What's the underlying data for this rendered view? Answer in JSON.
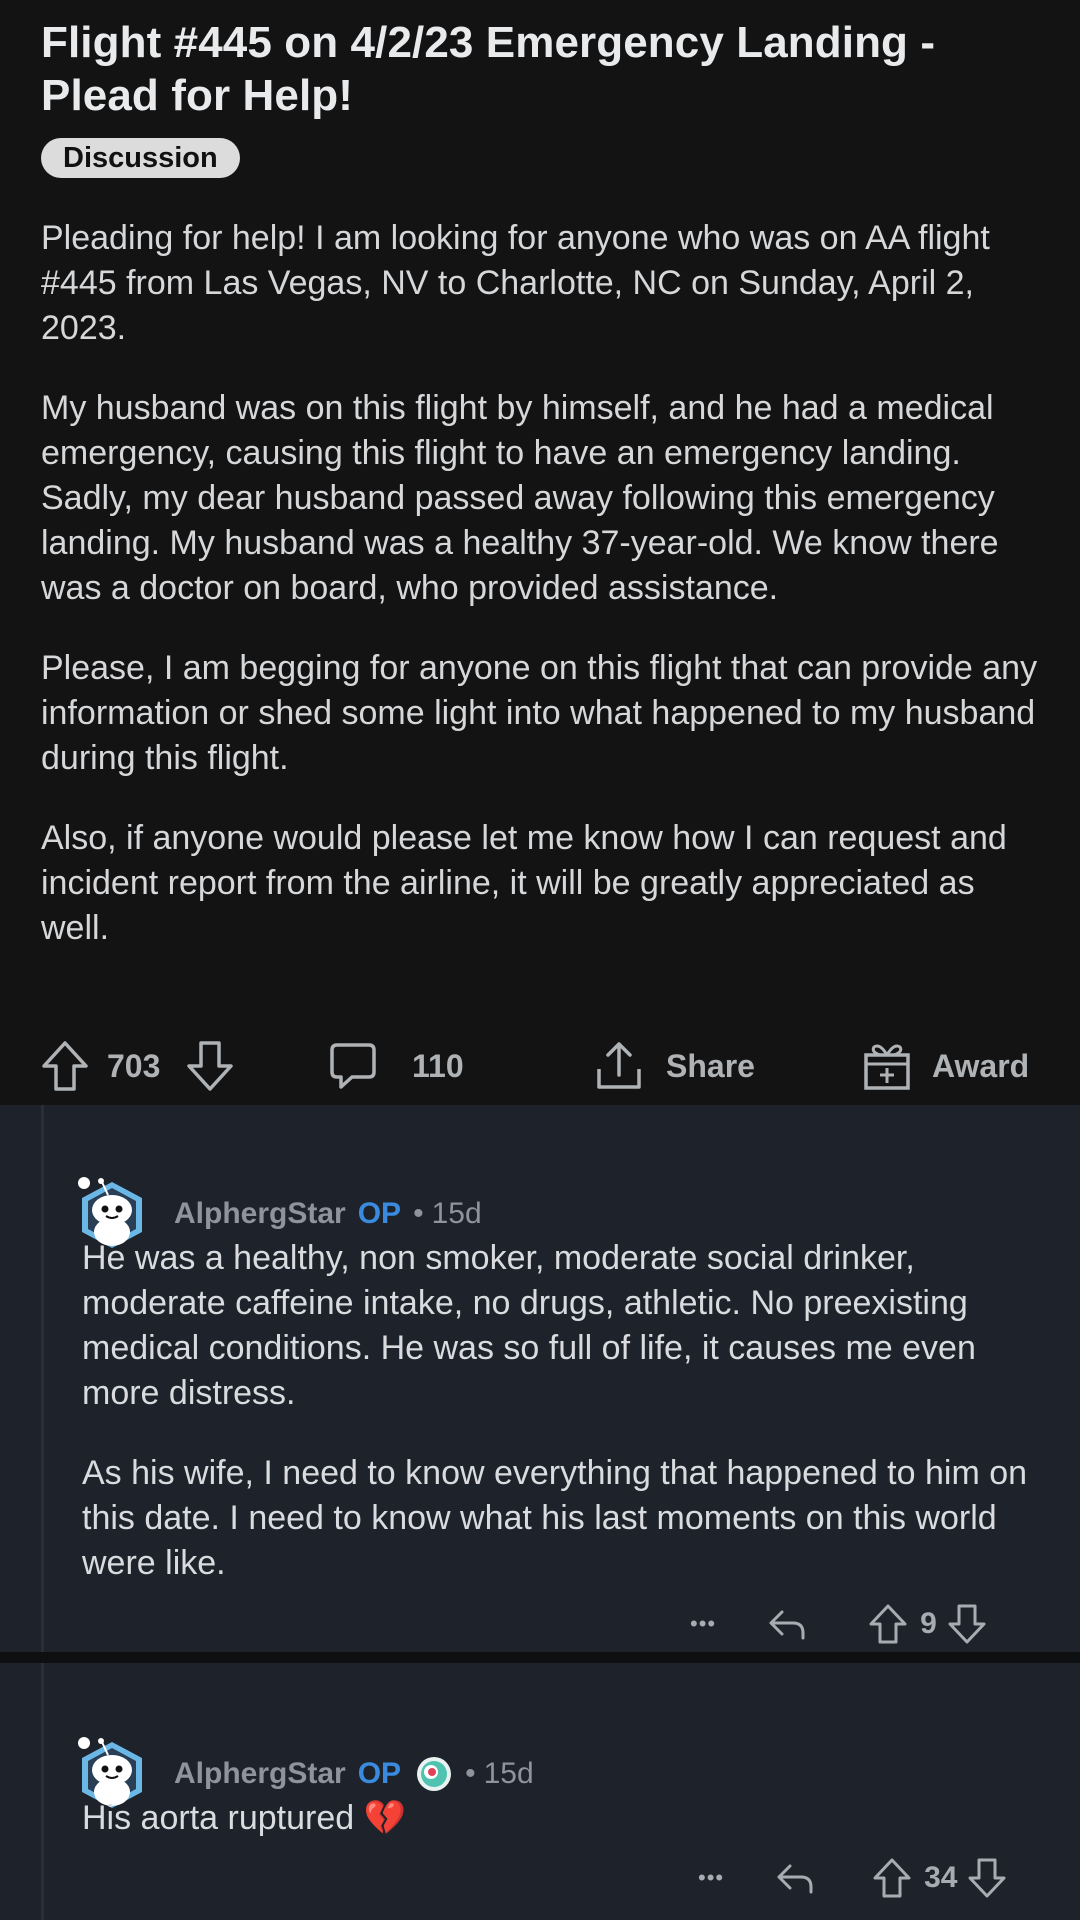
{
  "post": {
    "title": "Flight #445 on 4/2/23 Emergency Landing - Plead for Help!",
    "flair": "Discussion",
    "paragraphs": [
      "Pleading for help! I am looking for anyone who was on AA flight #445 from Las Vegas, NV to Charlotte, NC on Sunday, April 2, 2023.",
      "My husband was on this flight by himself, and he had a medical emergency, causing this flight to have an emergency landing. Sadly, my dear husband passed away following this emergency landing. My husband was a healthy 37-year-old. We know there was a doctor on board, who provided assistance.",
      "Please, I am begging for anyone on this flight that can provide any information or shed some light into what happened to my husband during this flight.",
      "Also, if anyone would please let me know how I can request and incident report from the airline, it will be greatly appreciated as well."
    ],
    "actions": {
      "votes": "703",
      "comments": "110",
      "share_label": "Share",
      "award_label": "Award"
    }
  },
  "comments": [
    {
      "username": "AlphergStar",
      "op_badge": "OP",
      "separator": "•",
      "age": "15d",
      "paragraphs": [
        "He was a healthy, non smoker, moderate social drinker, moderate caffeine intake, no drugs, athletic. No preexisting medical conditions. He was so full of life, it causes me even more distress.",
        "As his wife, I need to know everything that happened to him on this date. I need to know what his last moments on this world were like."
      ],
      "more": "•••",
      "votes": "9"
    },
    {
      "username": "AlphergStar",
      "op_badge": "OP",
      "separator": "•",
      "age": "15d",
      "paragraphs": [
        "His aorta ruptured 💔"
      ],
      "more": "•••",
      "votes": "34"
    }
  ],
  "colors": {
    "post_bg": "#131314",
    "comment_bg": "#1e232b",
    "op_blue": "#3a8be0",
    "flair_bg": "#dcdcdc"
  }
}
